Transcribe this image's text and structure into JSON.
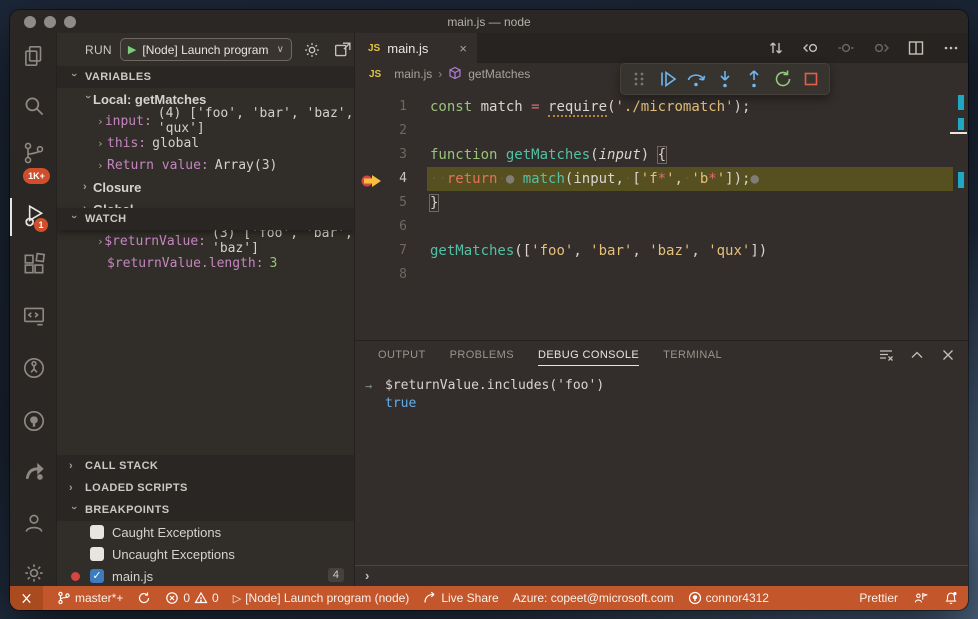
{
  "window": {
    "title": "main.js — node"
  },
  "activity_bar": {
    "items": [
      {
        "name": "explorer"
      },
      {
        "name": "search"
      },
      {
        "name": "source-control",
        "badge": "1K+"
      },
      {
        "name": "run-and-debug",
        "badge": "1",
        "active": true
      },
      {
        "name": "extensions"
      },
      {
        "name": "remote-explorer"
      },
      {
        "name": "live-share"
      },
      {
        "name": "github"
      },
      {
        "name": "gitlens"
      },
      {
        "name": "accounts"
      },
      {
        "name": "settings"
      }
    ]
  },
  "sidebar": {
    "run_label": "RUN",
    "launch_select": "[Node] Launch program",
    "variables": {
      "header": "VARIABLES",
      "scope_label": "Local: getMatches",
      "rows": [
        {
          "name": "input:",
          "value": "(4) ['foo', 'bar', 'baz', 'qux']"
        },
        {
          "name": "this:",
          "value": "global"
        },
        {
          "name": "Return value:",
          "value": "Array(3)"
        }
      ],
      "closure_label": "Closure",
      "global_label": "Global"
    },
    "watch": {
      "header": "WATCH",
      "rows": [
        {
          "name": "$returnValue:",
          "value": "(3) ['foo', 'bar', 'baz']"
        },
        {
          "name": "$returnValue.length:",
          "value": "3"
        }
      ]
    },
    "call_stack_header": "CALL STACK",
    "loaded_scripts_header": "LOADED SCRIPTS",
    "breakpoints": {
      "header": "BREAKPOINTS",
      "rows": [
        {
          "label": "Caught Exceptions",
          "checked": false
        },
        {
          "label": "Uncaught Exceptions",
          "checked": false
        },
        {
          "label": "main.js",
          "checked": true,
          "breakpoint_dot": true,
          "badge": "4"
        }
      ]
    }
  },
  "editor": {
    "tab": {
      "js_badge": "JS",
      "label": "main.js",
      "close": "×"
    },
    "breadcrumb": {
      "js_badge": "JS",
      "file": "main.js",
      "separator": "›",
      "symbol": "getMatches"
    },
    "code_lines": [
      {
        "num": "1",
        "tokens": [
          {
            "c": "kw",
            "t": "const"
          },
          {
            "c": "plain",
            "t": " match "
          },
          {
            "c": "op",
            "t": "="
          },
          {
            "c": "plain",
            "t": " "
          },
          {
            "c": "req",
            "t": "require"
          },
          {
            "c": "plain",
            "t": "("
          },
          {
            "c": "str",
            "t": "'./micromatch'"
          },
          {
            "c": "plain",
            "t": ");"
          }
        ]
      },
      {
        "num": "2",
        "tokens": []
      },
      {
        "num": "3",
        "tokens": [
          {
            "c": "kw",
            "t": "function"
          },
          {
            "c": "plain",
            "t": " "
          },
          {
            "c": "fn",
            "t": "getMatches"
          },
          {
            "c": "plain",
            "t": "("
          },
          {
            "c": "param",
            "t": "input"
          },
          {
            "c": "plain",
            "t": ") "
          },
          {
            "c": "bracket",
            "t": "{"
          }
        ]
      },
      {
        "num": "4",
        "current": true,
        "tokens": [
          {
            "c": "ws",
            "t": "··"
          },
          {
            "c": "ret",
            "t": "return"
          },
          {
            "c": "ws",
            "t": "·"
          },
          {
            "c": "dot",
            "t": "●"
          },
          {
            "c": "plain",
            "t": " "
          },
          {
            "c": "fn",
            "t": "match"
          },
          {
            "c": "plain",
            "t": "(input,"
          },
          {
            "c": "ws",
            "t": "·"
          },
          {
            "c": "plain",
            "t": "["
          },
          {
            "c": "str",
            "t": "'f"
          },
          {
            "c": "star",
            "t": "*"
          },
          {
            "c": "str",
            "t": "'"
          },
          {
            "c": "plain",
            "t": ","
          },
          {
            "c": "ws",
            "t": "·"
          },
          {
            "c": "str",
            "t": "'b"
          },
          {
            "c": "star",
            "t": "*"
          },
          {
            "c": "str",
            "t": "'"
          },
          {
            "c": "plain",
            "t": "]);"
          },
          {
            "c": "dot",
            "t": "●"
          }
        ]
      },
      {
        "num": "5",
        "tokens": [
          {
            "c": "bracket",
            "t": "}"
          }
        ]
      },
      {
        "num": "6",
        "tokens": []
      },
      {
        "num": "7",
        "tokens": [
          {
            "c": "fn",
            "t": "getMatches"
          },
          {
            "c": "plain",
            "t": "(["
          },
          {
            "c": "str",
            "t": "'foo'"
          },
          {
            "c": "plain",
            "t": ", "
          },
          {
            "c": "str",
            "t": "'bar'"
          },
          {
            "c": "plain",
            "t": ", "
          },
          {
            "c": "str",
            "t": "'baz'"
          },
          {
            "c": "plain",
            "t": ", "
          },
          {
            "c": "str",
            "t": "'qux'"
          },
          {
            "c": "plain",
            "t": "])"
          }
        ]
      },
      {
        "num": "8",
        "tokens": []
      }
    ]
  },
  "debug_toolbar": {
    "buttons": [
      "drag-grip",
      "continue",
      "step-over",
      "step-into",
      "step-out",
      "restart",
      "stop"
    ]
  },
  "panel": {
    "tabs": [
      "OUTPUT",
      "PROBLEMS",
      "DEBUG CONSOLE",
      "TERMINAL"
    ],
    "active_tab": "DEBUG CONSOLE",
    "entries": [
      {
        "gutter": "→",
        "input": "$returnValue.includes('foo')",
        "output": "true"
      }
    ],
    "prompt": "›"
  },
  "status_bar": {
    "branch": "master*+",
    "errors": "0",
    "warnings": "0",
    "play": "▷",
    "debug_status": "[Node] Launch program (node)",
    "live_share": "Live Share",
    "azure": "Azure: copeet@microsoft.com",
    "account": "connor4312",
    "prettier": "Prettier"
  },
  "icons": {
    "activity": [
      "files-icon",
      "search-icon",
      "source-control-icon",
      "debug-icon",
      "extensions-icon",
      "remote-icon",
      "live-share-icon",
      "github-icon",
      "gitlens-icon",
      "account-icon",
      "gear-icon"
    ],
    "debug_toolbar": [
      "continue-icon",
      "step-over-icon",
      "step-into-icon",
      "step-out-icon",
      "restart-icon",
      "stop-icon"
    ],
    "colors": {
      "status_bar": "#c4562b",
      "badge": "#d14e2a",
      "current_line": "#565020",
      "breakpoint": "#d64541",
      "true_blue": "#61afef"
    }
  }
}
